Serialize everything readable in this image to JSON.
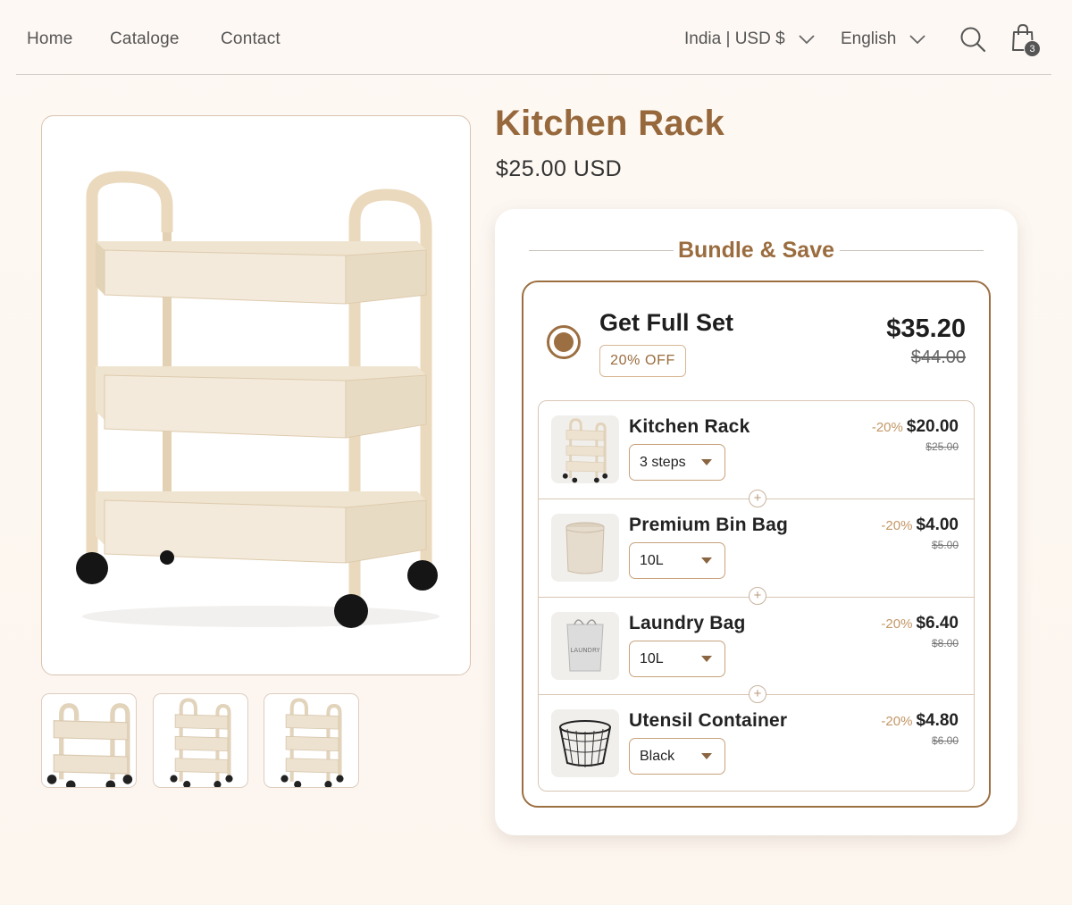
{
  "nav": {
    "links": [
      "Home",
      "Cataloge",
      "Contact"
    ],
    "country": "India | USD $",
    "language": "English",
    "search_icon": "search-icon",
    "cart_icon": "shopping-bag-icon",
    "cart_count": "3"
  },
  "product": {
    "title": "Kitchen Rack",
    "price": "$25.00 USD"
  },
  "bundle": {
    "heading": "Bundle & Save",
    "offer": {
      "title": "Get Full Set",
      "badge": "20% OFF",
      "price": "$35.20",
      "compare_price": "$44.00",
      "selected": true
    },
    "items": [
      {
        "name": "Kitchen Rack",
        "option": "3 steps",
        "discount": "-20%",
        "price": "$20.00",
        "compare_price": "$25.00"
      },
      {
        "name": "Premium Bin Bag",
        "option": "10L",
        "discount": "-20%",
        "price": "$4.00",
        "compare_price": "$5.00"
      },
      {
        "name": "Laundry Bag",
        "option": "10L",
        "discount": "-20%",
        "price": "$6.40",
        "compare_price": "$8.00"
      },
      {
        "name": "Utensil Container",
        "option": "Black",
        "discount": "-20%",
        "price": "$4.80",
        "compare_price": "$6.00"
      }
    ],
    "laundry_print": "LAUNDRY"
  },
  "colors": {
    "accent": "#9c6f42",
    "title": "#96683c",
    "rack": "#ece0cc"
  }
}
